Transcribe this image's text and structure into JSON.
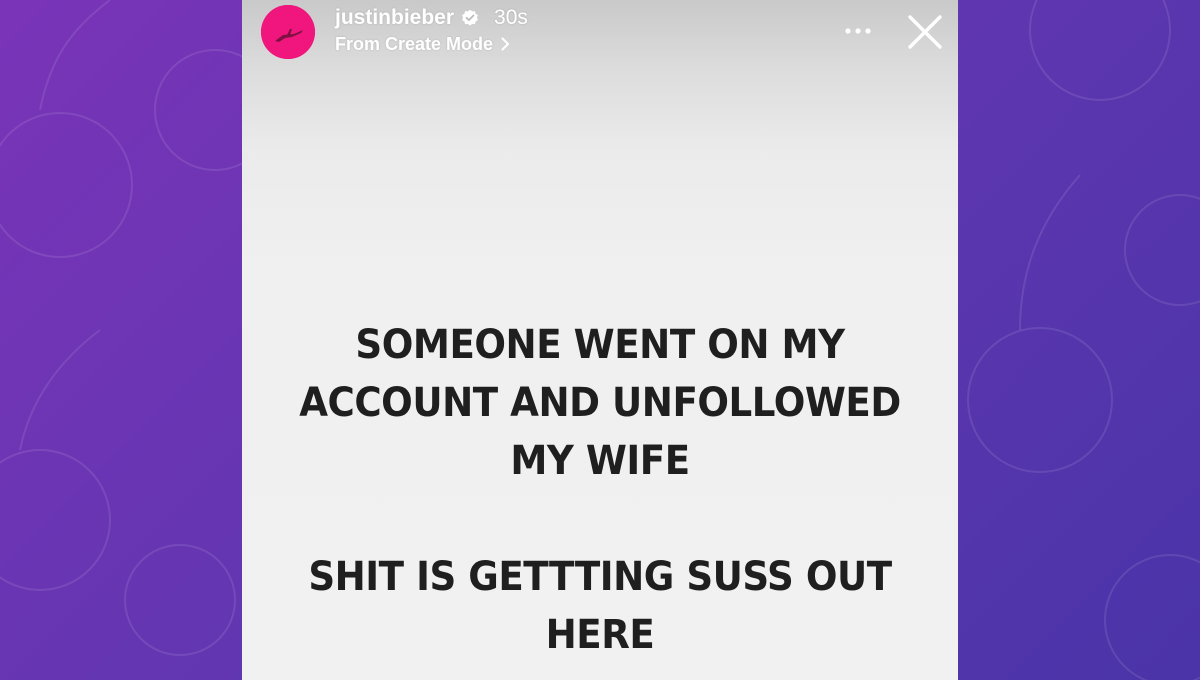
{
  "colors": {
    "background_start": "#7a34b8",
    "background_end": "#4a34a8",
    "story_bg": "#f1f1f1",
    "text": "#1f1f1f",
    "avatar": "#f0167d"
  },
  "story": {
    "header": {
      "username": "justinbieber",
      "verified_icon": "verified-badge-icon",
      "time": "30s",
      "subtitle": "From Create Mode",
      "more_icon": "more-dots-icon",
      "close_icon": "close-icon"
    },
    "message": {
      "lines": [
        "SOMEONE WENT ON MY",
        "ACCOUNT AND UNFOLLOWED",
        "MY WIFE",
        "SHIT IS GETTTING SUSS OUT",
        "HERE"
      ]
    }
  }
}
